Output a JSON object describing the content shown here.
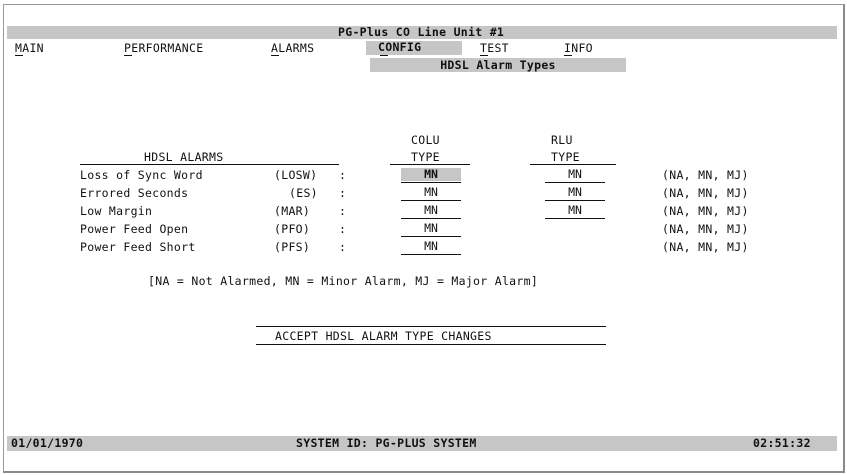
{
  "title": "PG-Plus CO Line Unit #1",
  "menu": {
    "main": "MAIN",
    "performance": "PERFORMANCE",
    "alarms": "ALARMS",
    "config": "CONFIG",
    "test": "TEST",
    "info": "INFO"
  },
  "submenu": "HDSL Alarm Types",
  "table": {
    "section_header": "HDSL ALARMS",
    "colu_header_1": "COLU",
    "colu_header_2": "TYPE",
    "rlu_header_1": "RLU",
    "rlu_header_2": "TYPE",
    "rows": [
      {
        "label": "Loss of Sync Word",
        "abbr": "(LOSW)",
        "colu": "MN",
        "rlu": "MN",
        "options": "(NA, MN, MJ)"
      },
      {
        "label": "Errored Seconds",
        "abbr": "(ES)",
        "colu": "MN",
        "rlu": "MN",
        "options": "(NA, MN, MJ)"
      },
      {
        "label": "Low Margin",
        "abbr": "(MAR)",
        "colu": "MN",
        "rlu": "MN",
        "options": "(NA, MN, MJ)"
      },
      {
        "label": "Power Feed Open",
        "abbr": "(PFO)",
        "colu": "MN",
        "rlu": "",
        "options": "(NA, MN, MJ)"
      },
      {
        "label": "Power Feed Short",
        "abbr": "(PFS)",
        "colu": "MN",
        "rlu": "",
        "options": "(NA, MN, MJ)"
      }
    ],
    "colon": ":"
  },
  "legend": "[NA = Not Alarmed, MN = Minor Alarm, MJ = Major Alarm]",
  "accept_button": "ACCEPT HDSL ALARM TYPE CHANGES",
  "footer": {
    "date": "01/01/1970",
    "system_id": "SYSTEM ID: PG-PLUS SYSTEM",
    "time": "02:51:32"
  },
  "colors": {
    "background": "#ffffff",
    "bar": "#c6c6c6",
    "text": "#111111"
  }
}
